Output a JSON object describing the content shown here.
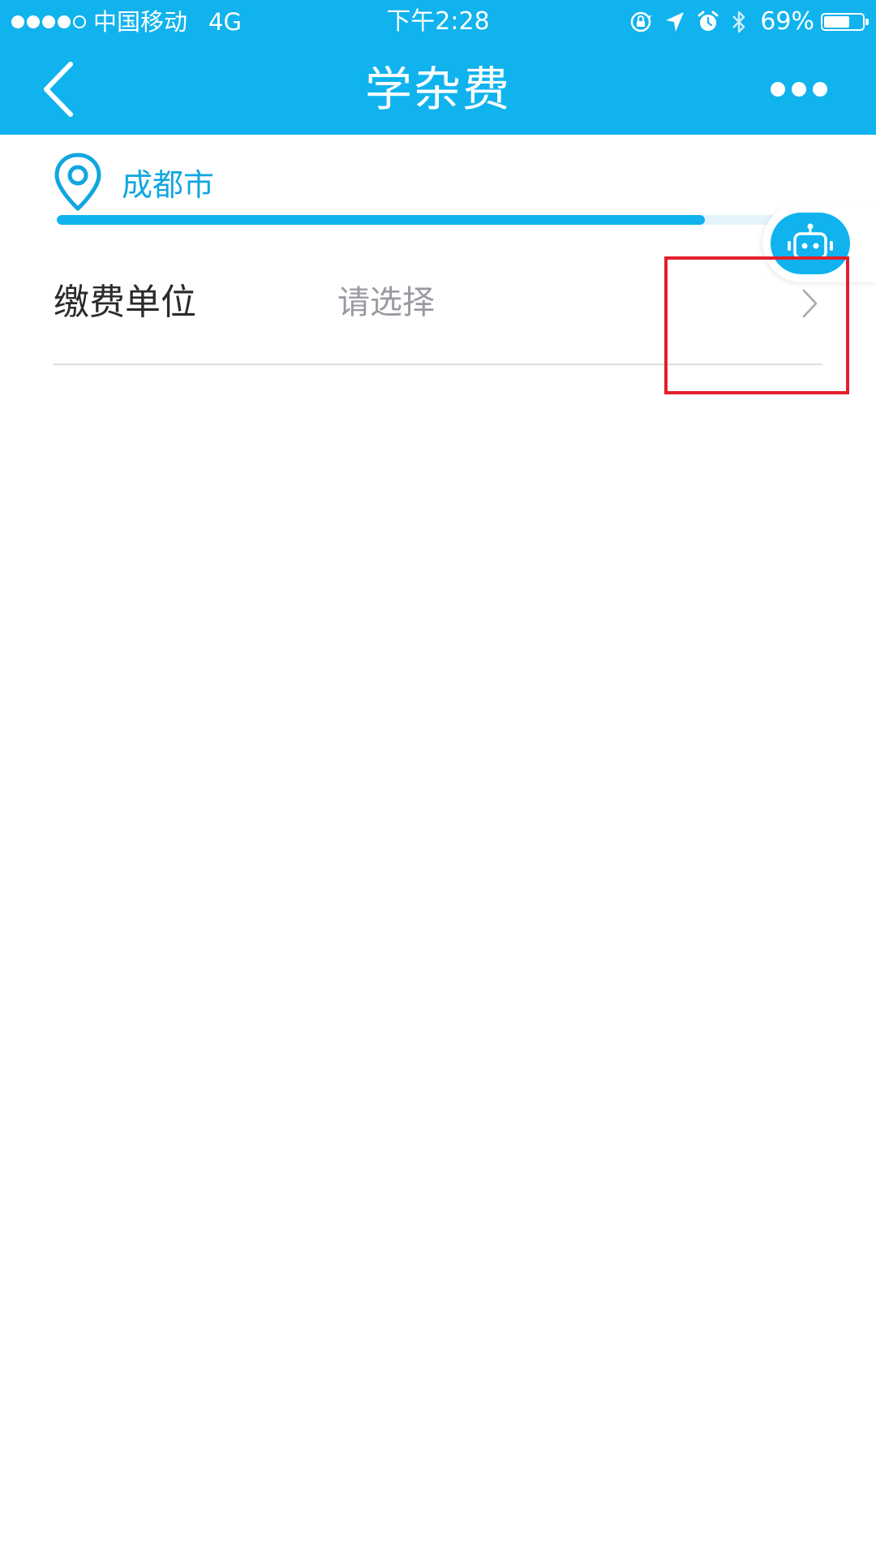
{
  "status_bar": {
    "carrier": "中国移动",
    "network": "4G",
    "time": "下午2:28",
    "battery_percent_label": "69%",
    "battery_level": 0.69,
    "signal_bars_filled": 4,
    "signal_bars_total": 5,
    "icons": [
      "signal-dots-icon",
      "rotation-lock-icon",
      "location-arrow-icon",
      "alarm-icon",
      "bluetooth-icon",
      "battery-icon"
    ]
  },
  "nav": {
    "title": "学杂费",
    "back_icon": "chevron-left-icon",
    "more_icon": "ellipsis-icon"
  },
  "location": {
    "city": "成都市",
    "icon": "map-pin-icon"
  },
  "progress": {
    "fill_fraction": 0.85
  },
  "assistant": {
    "icon": "robot-icon"
  },
  "form": {
    "rows": [
      {
        "label": "缴费单位",
        "placeholder": "请选择",
        "icon": "chevron-right-icon"
      }
    ]
  },
  "colors": {
    "brand": "#10b3ee",
    "location_text": "#10a6e0",
    "label_text": "#2b2b2b",
    "placeholder_text": "#9a9aa2",
    "divider": "#dddddd",
    "highlight": "#e3202a",
    "background": "#ffffff"
  }
}
